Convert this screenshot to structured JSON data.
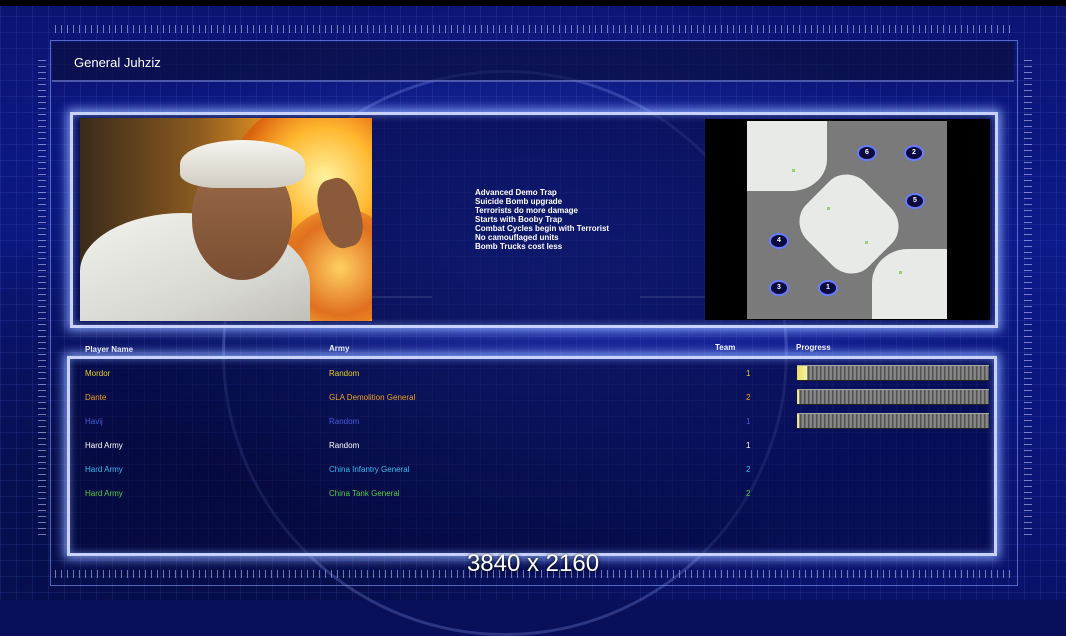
{
  "header": {
    "title": "General Juhziz"
  },
  "general": {
    "traits": [
      "Advanced Demo Trap",
      "Suicide Bomb upgrade",
      "Terrorists do more damage",
      "Starts with Booby Trap",
      "Combat Cycles begin with Terrorist",
      "No camouflaged units",
      "Bomb Trucks cost less"
    ]
  },
  "map": {
    "start_positions": [
      "6",
      "2",
      "5",
      "4",
      "3",
      "1"
    ]
  },
  "table": {
    "columns": {
      "name": "Player Name",
      "army": "Army",
      "team": "Team",
      "progress": "Progress"
    },
    "rows": [
      {
        "name": "Mordor",
        "army": "Random",
        "team": "1",
        "color": "#e8d020",
        "progress": 0.05
      },
      {
        "name": "Dante",
        "army": "GLA Demolition General",
        "team": "2",
        "color": "#f0a020",
        "progress": 0.01
      },
      {
        "name": "Havij",
        "army": "Random",
        "team": "1",
        "color": "#4a5ad8",
        "progress": 0.0
      },
      {
        "name": "Hard Army",
        "army": "Random",
        "team": "1",
        "color": "#ffffff",
        "progress": null
      },
      {
        "name": "Hard Army",
        "army": "China Infantry General",
        "team": "2",
        "color": "#38b8f0",
        "progress": null
      },
      {
        "name": "Hard Army",
        "army": "China Tank General",
        "team": "2",
        "color": "#58c848",
        "progress": null
      }
    ]
  },
  "watermark": "3840 x 2160"
}
